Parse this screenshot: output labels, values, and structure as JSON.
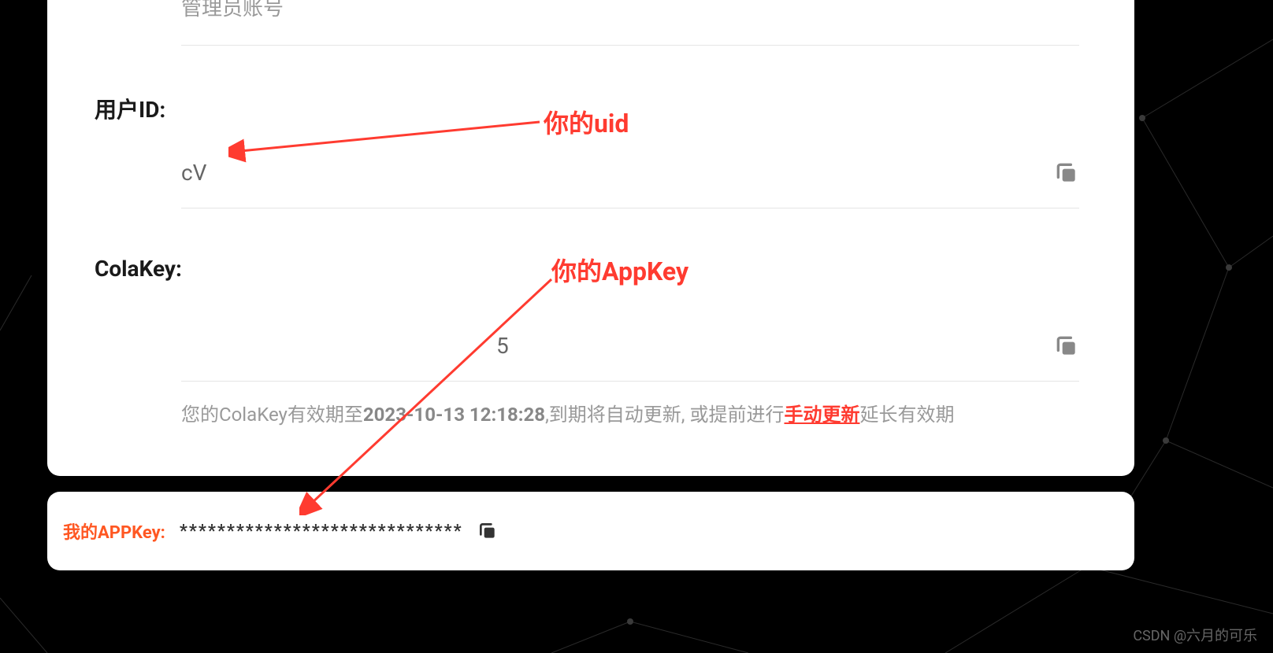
{
  "admin_placeholder": "管理员账号",
  "user_id": {
    "label": "用户ID:",
    "value": "cV"
  },
  "cola_key": {
    "label": "ColaKey:",
    "value_fragment": "5",
    "expiry_prefix": "您的ColaKey有效期至",
    "expiry_date": "2023-10-13 12:18:28",
    "expiry_mid": ",到期将自动更新, 或提前进行",
    "expiry_link": "手动更新",
    "expiry_suffix": "延长有效期"
  },
  "my_appkey": {
    "label": "我的APPKey:",
    "value": "******************************"
  },
  "annotations": {
    "uid": "你的uid",
    "appkey": "你的AppKey"
  },
  "watermark": "CSDN @六月的可乐"
}
